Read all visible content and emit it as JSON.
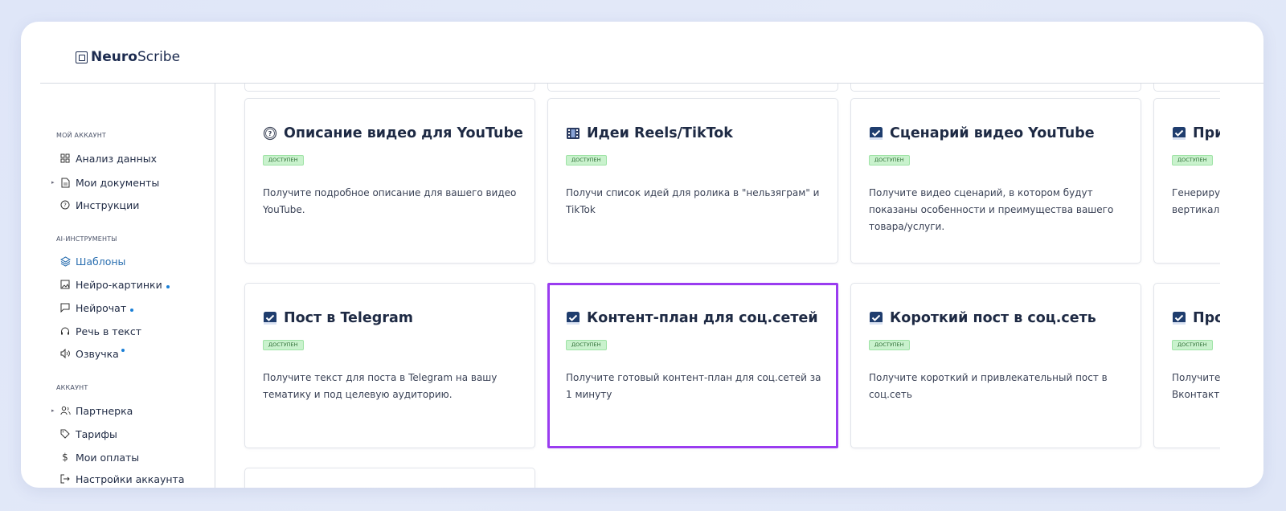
{
  "app": {
    "brand_bold": "Neuro",
    "brand_light": "Scribe"
  },
  "sidebar": {
    "sections": [
      {
        "title": "МОЙ АККАУНТ",
        "items": [
          {
            "label": "Анализ данных",
            "icon": "grid-icon"
          },
          {
            "label": "Мои документы",
            "icon": "document-icon"
          },
          {
            "label": "Инструкции",
            "icon": "help-circle-icon"
          }
        ]
      },
      {
        "title": "AI-ИНСТРУМЕНТЫ",
        "items": [
          {
            "label": "Шаблоны",
            "icon": "layers-icon"
          },
          {
            "label": "Нейро-картинки",
            "icon": "image-icon"
          },
          {
            "label": "Нейрочат",
            "icon": "chat-icon"
          },
          {
            "label": "Речь в текст",
            "icon": "headphones-icon"
          },
          {
            "label": "Озвучка",
            "icon": "speaker-icon"
          }
        ]
      },
      {
        "title": "АККАУНТ",
        "items": [
          {
            "label": "Партнерка",
            "icon": "users-icon"
          },
          {
            "label": "Тарифы",
            "icon": "tag-icon"
          },
          {
            "label": "Мои оплаты",
            "icon": "dollar-icon"
          },
          {
            "label": "Настройки аккаунта",
            "icon": "logout-icon"
          }
        ]
      }
    ]
  },
  "cards": [
    {
      "title": "Описание видео для YouTube",
      "badge": "ДОСТУПЕН",
      "desc": "Получите подробное описание для вашего видео YouTube.",
      "icon": "question-icon"
    },
    {
      "title": "Идеи Reels/TikTok",
      "badge": "ДОСТУПЕН",
      "desc": "Получи список идей для ролика в \"нельзяграм\" и TikTok",
      "icon": "film-icon"
    },
    {
      "title": "Сценарий видео YouTube",
      "badge": "ДОСТУПЕН",
      "desc": "Получите видео сценарий, в котором будут показаны особенности и преимущества вашего товара/услуги.",
      "icon": "checkbox-icon"
    },
    {
      "title": "При",
      "badge": "ДОСТУПЕН",
      "desc": "Генериру вертикал",
      "icon": "checkbox-icon"
    },
    {
      "title": "Пост в Telegram",
      "badge": "ДОСТУПЕН",
      "desc": "Получите текст для поста в Telegram на вашу тематику и под целевую аудиторию.",
      "icon": "checkbox-icon"
    },
    {
      "title": "Контент-план для соц.сетей",
      "badge": "ДОСТУПЕН",
      "desc": "Получите готовый контент-план для соц.сетей за 1 минуту",
      "icon": "checkbox-icon"
    },
    {
      "title": "Короткий пост в соц.сеть",
      "badge": "ДОСТУПЕН",
      "desc": "Получите короткий и привлекательный пост в соц.сеть",
      "icon": "checkbox-icon"
    },
    {
      "title": "Про",
      "badge": "ДОСТУПЕН",
      "desc": "Получите Вконтакт",
      "icon": "checkbox-icon"
    }
  ],
  "colors": {
    "accent": "#9a3cf0",
    "active_nav": "#2a6fb0",
    "badge_bg": "#c9f2cd",
    "brand": "#1c2b4f"
  }
}
